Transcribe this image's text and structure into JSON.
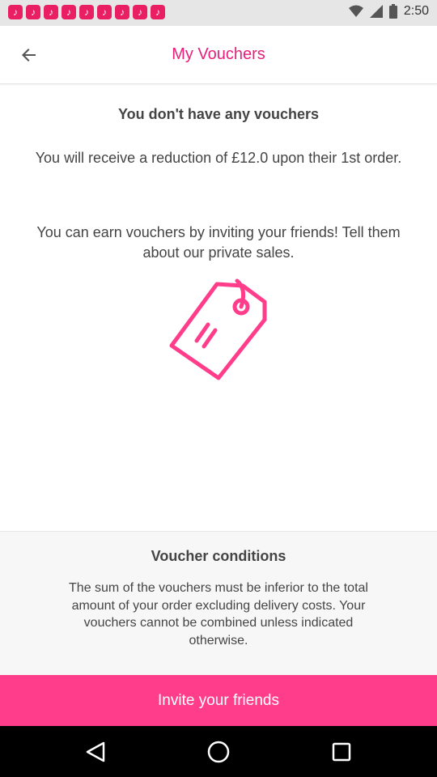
{
  "status_bar": {
    "time": "2:50",
    "notification_icons": [
      "music-note-icon",
      "music-note-icon",
      "music-note-icon",
      "music-note-icon",
      "music-note-icon",
      "music-note-icon",
      "music-note-icon",
      "music-note-icon",
      "music-note-icon"
    ]
  },
  "toolbar": {
    "title": "My Vouchers",
    "back_icon": "arrow-back-icon"
  },
  "content": {
    "headline": "You don't have any vouchers",
    "reduction_text": "You will receive a reduction of £12.0 upon their 1st order.",
    "earn_text": "You can earn vouchers by inviting your friends! Tell them about our private sales.",
    "illustration_icon": "price-tag-icon"
  },
  "conditions": {
    "title": "Voucher conditions",
    "text": "The sum of the vouchers must be inferior to the total amount of your order excluding delivery costs. Your vouchers cannot be combined unless indicated otherwise."
  },
  "invite_button": {
    "label": "Invite your friends"
  },
  "colors": {
    "accent": "#e91e7a",
    "button": "#ff3d8b",
    "text": "#444444",
    "conditions_bg": "#f7f7f7"
  },
  "nav_bar": {
    "buttons": [
      "back-triangle-icon",
      "home-circle-icon",
      "recents-square-icon"
    ]
  }
}
